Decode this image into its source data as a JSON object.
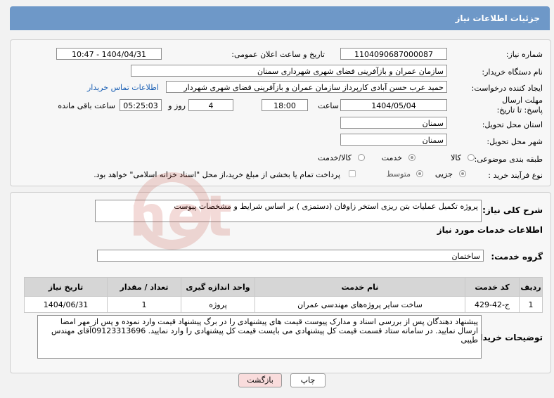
{
  "header": {
    "title": "جزئیات اطلاعات نیاز"
  },
  "form": {
    "need_number_label": "شماره نیاز:",
    "need_number": "1104090687000087",
    "announce_label": "تاریخ و ساعت اعلان عمومی:",
    "announce_value": "1404/04/31 - 10:47",
    "buyer_org_label": "نام دستگاه خریدار:",
    "buyer_org": "سازمان عمران و بازآفرینی فضای شهری شهرداری سمنان",
    "creator_label": "ایجاد کننده درخواست:",
    "creator": "حمید عرب حسن آبادی کارپرداز سازمان عمران و بازآفرینی فضای شهری شهردار",
    "contact_link": "اطلاعات تماس خریدار",
    "deadline_label": "مهلت ارسال پاسخ: تا تاریخ:",
    "deadline_date": "1404/05/04",
    "time_label": "ساعت",
    "deadline_time": "18:00",
    "days_value": "4",
    "days_label": "روز و",
    "remaining_time": "05:25:03",
    "remaining_label": "ساعت باقی مانده",
    "province_label": "استان محل تحویل:",
    "province": "سمنان",
    "city_label": "شهر محل تحویل:",
    "city": "سمنان",
    "category_label": "طبقه بندی موضوعی:",
    "category_options": [
      "کالا",
      "خدمت",
      "کالا/خدمت"
    ],
    "category_selected": "خدمت",
    "process_label": "نوع فرآیند خرید :",
    "process_options": [
      "جزیی",
      "متوسط"
    ],
    "process_selected": "جزیی",
    "payment_note": "پرداخت تمام یا بخشی از مبلغ خرید،از محل \"اسناد خزانه اسلامی\" خواهد بود."
  },
  "summary": {
    "label": "شرح کلی نیاز:",
    "text": "پروژه تکمیل عملیات بتن ریزی استخر زاوقان (دستمزی ) بر اساس شرایط و مشخصات پیوست"
  },
  "services": {
    "section_title": "اطلاعات خدمات مورد نیاز",
    "group_label": "گروه خدمت:",
    "group_value": "ساختمان",
    "columns": [
      "ردیف",
      "کد خدمت",
      "نام خدمت",
      "واحد اندازه گیری",
      "تعداد / مقدار",
      "تاریخ نیاز"
    ],
    "rows": [
      [
        "1",
        "ج-42-429",
        "ساخت سایر پروژه‌های مهندسی عمران",
        "پروژه",
        "1",
        "1404/06/31"
      ]
    ]
  },
  "buyer_notes": {
    "label": "توضیحات خریدار:",
    "text": "پیشنهاد دهندگان پس از بررسی اسناد و مدارک پیوست قیمت های پیشنهادی را در برگ پیشنهاد قیمت وارد نموده و پس از مهر امضا ارسال نمایید. در سامانه ستاد قسمت قیمت کل پیشنهادی می بایست قیمت کل پیشنهادی را وارد نمایید. 09123313696آقای مهندس طیبی"
  },
  "buttons": {
    "print": "چاپ",
    "back": "بازگشت"
  },
  "watermark": "AriaTender.net",
  "colors": {
    "header": "#6e98c8",
    "link": "#1a5fb4",
    "back_button": "#f9dcdc"
  }
}
